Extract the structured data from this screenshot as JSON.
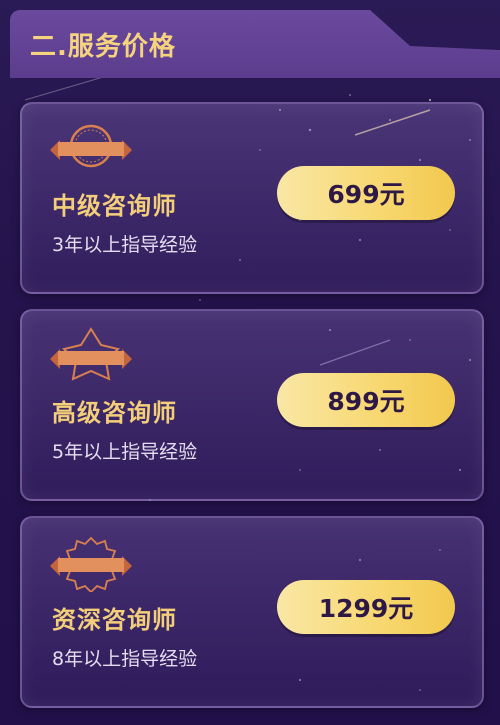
{
  "section": {
    "title": "二.服务价格"
  },
  "plans": [
    {
      "title": "中级咨询师",
      "subtitle": "3年以上指导经验",
      "price": "699元"
    },
    {
      "title": "高级咨询师",
      "subtitle": "5年以上指导经验",
      "price": "899元"
    },
    {
      "title": "资深咨询师",
      "subtitle": "8年以上指导经验",
      "price": "1299元"
    }
  ],
  "colors": {
    "accent_gold": "#f4cf7a",
    "button_gold": "#f7d76e",
    "background_purple": "#24134c",
    "badge_orange": "#d9804f"
  },
  "icons": [
    "round-medal-badge-icon",
    "star-medal-badge-icon",
    "gear-medal-badge-icon"
  ]
}
